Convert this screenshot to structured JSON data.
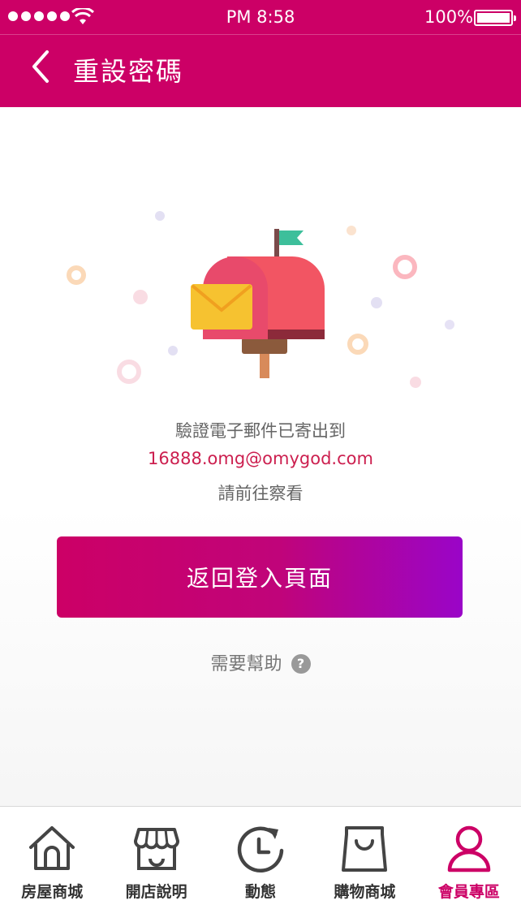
{
  "status_bar": {
    "time": "PM 8:58",
    "battery": "100%"
  },
  "header": {
    "title": "重設密碼"
  },
  "message": {
    "line1": "驗證電子郵件已寄出到",
    "email": "16888.omg@omygod.com",
    "line3": "請前往察看"
  },
  "return_button": "返回登入頁面",
  "help": {
    "label": "需要幫助",
    "icon_glyph": "?"
  },
  "tabs": [
    {
      "label": "房屋商城",
      "icon": "house-icon",
      "active": false
    },
    {
      "label": "開店說明",
      "icon": "store-icon",
      "active": false
    },
    {
      "label": "動態",
      "icon": "refresh-clock-icon",
      "active": false
    },
    {
      "label": "購物商城",
      "icon": "shopping-bag-icon",
      "active": false
    },
    {
      "label": "會員專區",
      "icon": "member-icon",
      "active": true
    }
  ],
  "colors": {
    "brand": "#cc0066",
    "accent_purple": "#9a05c8",
    "email_text": "#cc1f4f"
  }
}
